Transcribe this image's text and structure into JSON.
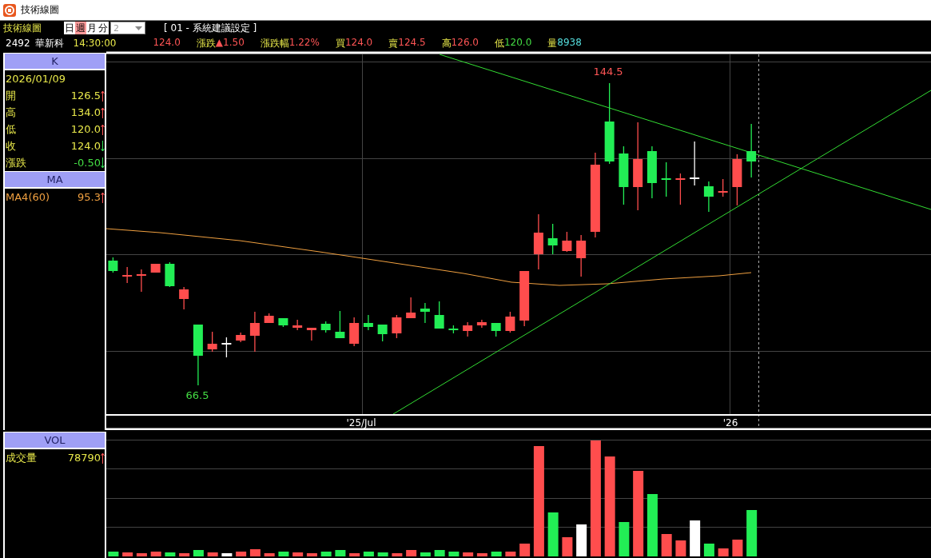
{
  "window": {
    "title": "技術線圖"
  },
  "toolbar": {
    "label": "技術線圖",
    "periods": [
      {
        "label": "日",
        "selected": false
      },
      {
        "label": "週",
        "selected": true
      },
      {
        "label": "月",
        "selected": false
      },
      {
        "label": "分",
        "selected": false
      }
    ],
    "count_select": {
      "value": "2",
      "disabled": true
    },
    "setting": "[ 01 - 系統建議設定 ]"
  },
  "quote": {
    "code": "2492",
    "name": "華新科",
    "time": "14:30:00",
    "items": [
      {
        "value": "124.0",
        "color": "#ff5555"
      },
      {
        "label": "漲跌",
        "value": "▲1.50",
        "color": "#ff5555"
      },
      {
        "label": "漲跌幅",
        "value": "1.22%",
        "color": "#ff5555"
      },
      {
        "label": "買",
        "value": "124.0",
        "color": "#ff5555"
      },
      {
        "label": "賣",
        "value": "124.5",
        "color": "#ff5555"
      },
      {
        "label": "高",
        "value": "126.0",
        "color": "#ff5555"
      },
      {
        "label": "低",
        "value": "120.0",
        "color": "#44dd44"
      },
      {
        "label": "量",
        "value": "8938",
        "color": "#55dddd"
      }
    ]
  },
  "panels": [
    {
      "title": "K",
      "kind": "price",
      "date": "2026/01/09",
      "rows": [
        {
          "label": "開",
          "value": "126.5",
          "color": "#e8e84a",
          "rising": true
        },
        {
          "label": "高",
          "value": "134.0",
          "color": "#e8e84a",
          "rising": true
        },
        {
          "label": "低",
          "value": "120.0",
          "color": "#e8e84a",
          "rising": true
        },
        {
          "label": "收",
          "value": "124.0",
          "color": "#e8e84a",
          "rising": false
        },
        {
          "label": "漲跌",
          "value": "-0.50",
          "color": "#44dd44",
          "rising": false
        }
      ]
    },
    {
      "title": "MA",
      "kind": "indicator",
      "rows": [
        {
          "label": "MA4(60)",
          "value": "95.3",
          "color": "#f0a040",
          "rising": true
        }
      ]
    }
  ],
  "main_chart": {
    "high_label": "144.5",
    "low_label": "66.5",
    "x_labels": [
      "'25/Jul",
      "'26"
    ]
  },
  "volume_panel": {
    "title": "VOL",
    "rows": [
      {
        "label": "成交量",
        "value": "78790",
        "color": "#e8e84a",
        "rising": true
      }
    ]
  }
}
